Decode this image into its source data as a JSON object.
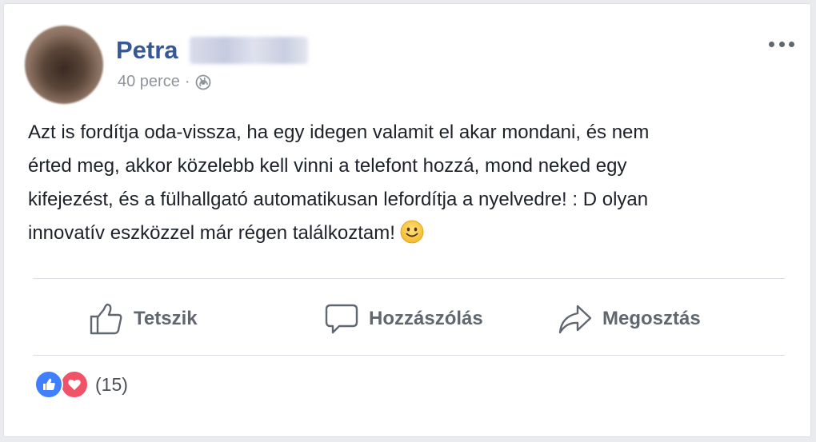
{
  "post": {
    "author": "Petra",
    "time": "40 perce",
    "separator": "·",
    "privacy_icon": "globe-icon",
    "menu_icon": "more-options-icon",
    "text": "Azt is fordítja oda-vissza, ha egy idegen valamit el akar mondani, és nem\nérted meg, akkor közelebb kell vinni a telefont hozzá, mond neked egy\nkifejezést, és a fülhallgató automatikusan lefordítja a nyelvedre! : D olyan\ninnovatív eszközzel már régen találkoztam!",
    "emoji": "slightly-smiling-face"
  },
  "actions": {
    "like_label": "Tetszik",
    "comment_label": "Hozzászólás",
    "share_label": "Megosztás"
  },
  "reactions": {
    "types": [
      "like",
      "love"
    ],
    "count": "(15)"
  },
  "colors": {
    "name": "#365899",
    "action_text": "#606770",
    "like": "#4080ff",
    "love": "#f25268",
    "meta": "#90949c"
  }
}
